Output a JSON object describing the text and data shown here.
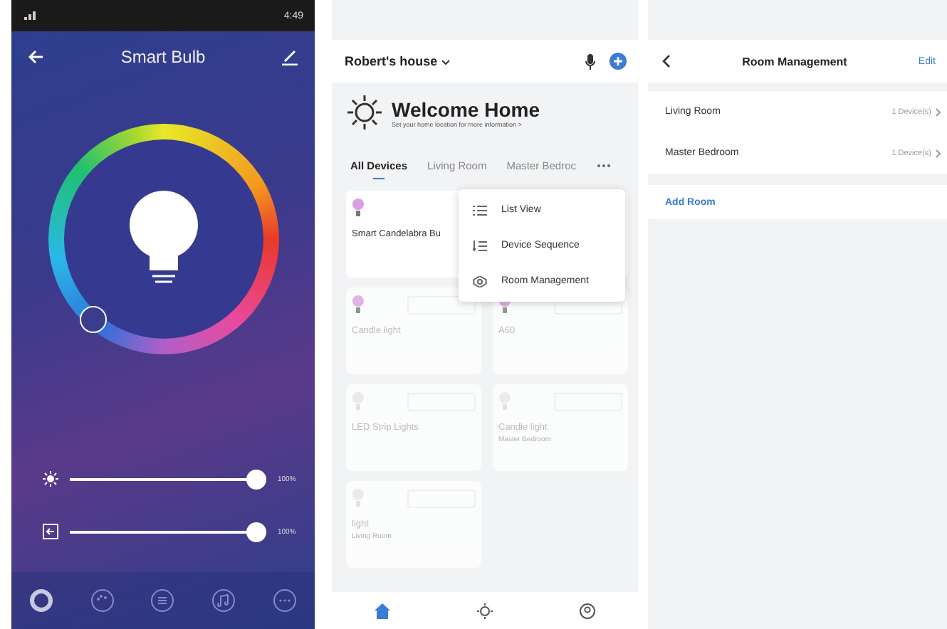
{
  "bulb_screen": {
    "status_bar": {
      "time": "4:49"
    },
    "title": "Smart Bulb",
    "sliders": [
      {
        "kind": "brightness",
        "level": 1,
        "reading": "100%"
      },
      {
        "kind": "temperature",
        "level": 1,
        "reading": "100%"
      }
    ],
    "bottom_tabs": [
      {
        "kind": "ring",
        "selected": true
      },
      {
        "kind": "palette",
        "selected": false
      },
      {
        "kind": "list",
        "selected": false
      },
      {
        "kind": "music",
        "selected": false
      },
      {
        "kind": "more",
        "selected": false
      }
    ]
  },
  "home_screen": {
    "home_name": "Robert's house",
    "welcome_title": "Welcome Home",
    "welcome_subtitle": "Set your home location for more information >",
    "tabs": [
      {
        "label": "All Devices",
        "selected": true
      },
      {
        "label": "Living Room",
        "selected": false
      },
      {
        "label": "Master Bedroc",
        "selected": false
      }
    ],
    "menu": [
      {
        "kind": "list",
        "label": "List View"
      },
      {
        "kind": "sequence",
        "label": "Device Sequence"
      },
      {
        "kind": "gear",
        "label": "Room Management"
      }
    ],
    "devices": [
      {
        "name": "Smart Candelabra Bu",
        "kind": "color",
        "offline": false
      },
      {
        "name": "Candle light",
        "kind": "color",
        "offline": true
      },
      {
        "name": "A60",
        "kind": "color",
        "offline": true
      },
      {
        "name": "LED Strip Lights",
        "kind": "white",
        "offline": true
      },
      {
        "name": "Candle light",
        "room": "Master Bedroom",
        "kind": "white",
        "offline": true
      },
      {
        "name": "light",
        "room": "Living Room",
        "kind": "white",
        "offline": true
      }
    ],
    "nav": [
      {
        "kind": "home",
        "selected": true
      },
      {
        "kind": "scene",
        "selected": false
      },
      {
        "kind": "me",
        "selected": false
      }
    ]
  },
  "rooms_screen": {
    "title": "Room Management",
    "edit": "Edit",
    "rooms": [
      {
        "name": "Living Room",
        "count": "1 Device(s)"
      },
      {
        "name": "Master Bedroom",
        "count": "1 Device(s)"
      }
    ],
    "add_room": "Add Room"
  }
}
